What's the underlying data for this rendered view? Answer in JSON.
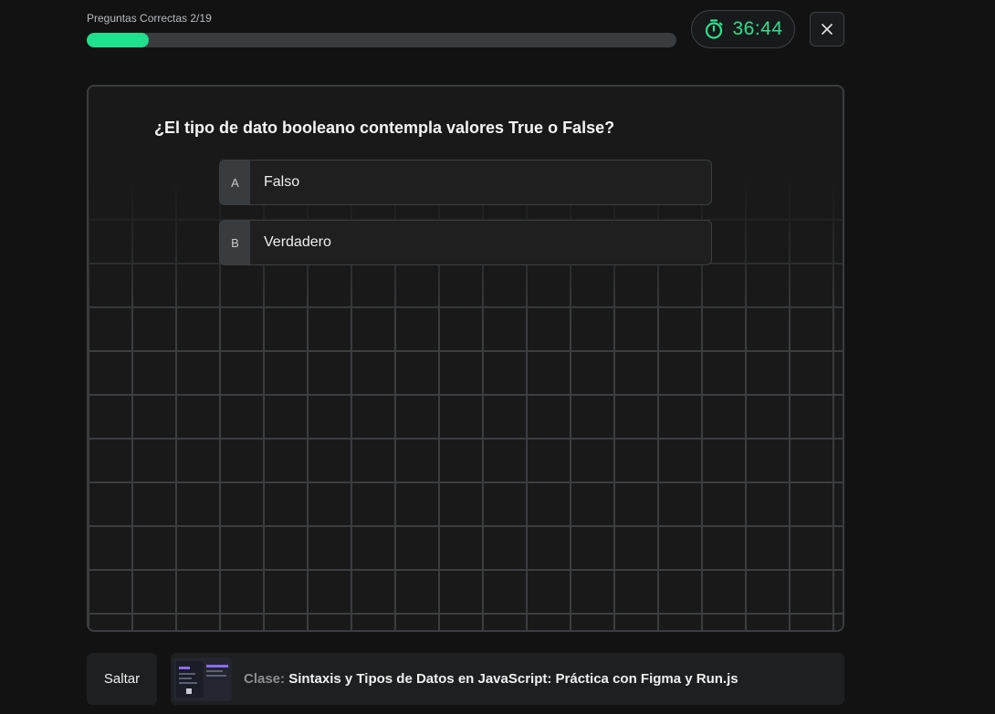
{
  "header": {
    "progress_label": "Preguntas Correctas 2/19",
    "progress_fraction": 0.1053,
    "timer": "36:44",
    "timer_icon": "stopwatch-icon",
    "close_icon": "close-icon"
  },
  "question": {
    "text": "¿El tipo de dato booleano contempla valores True o False?",
    "options": [
      {
        "letter": "A",
        "label": "Falso"
      },
      {
        "letter": "B",
        "label": "Verdadero"
      }
    ]
  },
  "footer": {
    "skip_label": "Saltar",
    "class_prefix": "Clase:",
    "class_title": "Sintaxis y Tipos de Datos en JavaScript: Práctica con Figma y Run.js"
  },
  "colors": {
    "accent": "#1fe08c",
    "background": "#121212",
    "panel": "#191919"
  }
}
